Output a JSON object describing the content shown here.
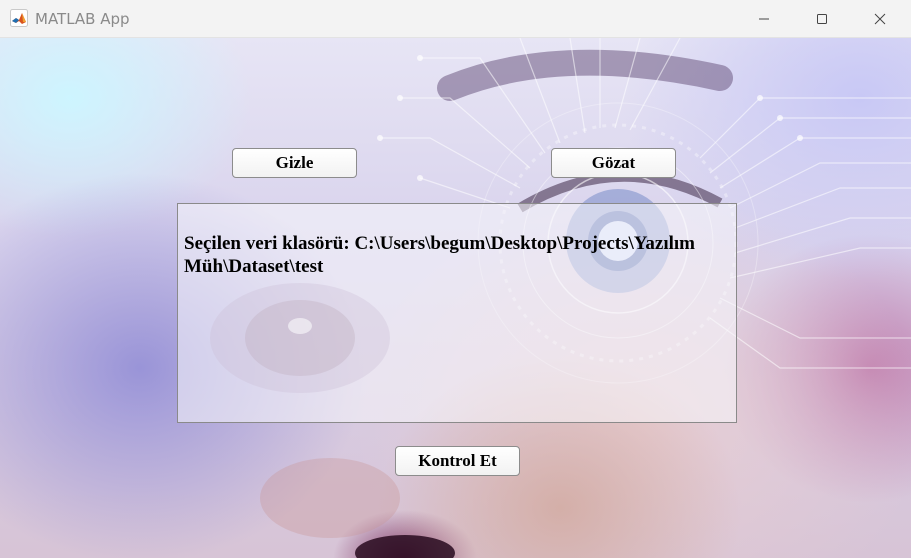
{
  "window": {
    "title": "MATLAB App",
    "controls": {
      "minimize_icon": "minimize-icon",
      "maximize_icon": "maximize-icon",
      "close_icon": "close-icon"
    }
  },
  "buttons": {
    "hide_label": "Gizle",
    "browse_label": "Gözat",
    "check_label": "Kontrol Et"
  },
  "panel": {
    "text": "Seçilen veri klasörü: C:\\Users\\begum\\Desktop\\Projects\\Yazılım Müh\\Dataset\\test"
  },
  "colors": {
    "button_border": "#8c8c8c",
    "panel_border": "#8a8a8a",
    "titlebar_bg": "#f3f3f3"
  }
}
